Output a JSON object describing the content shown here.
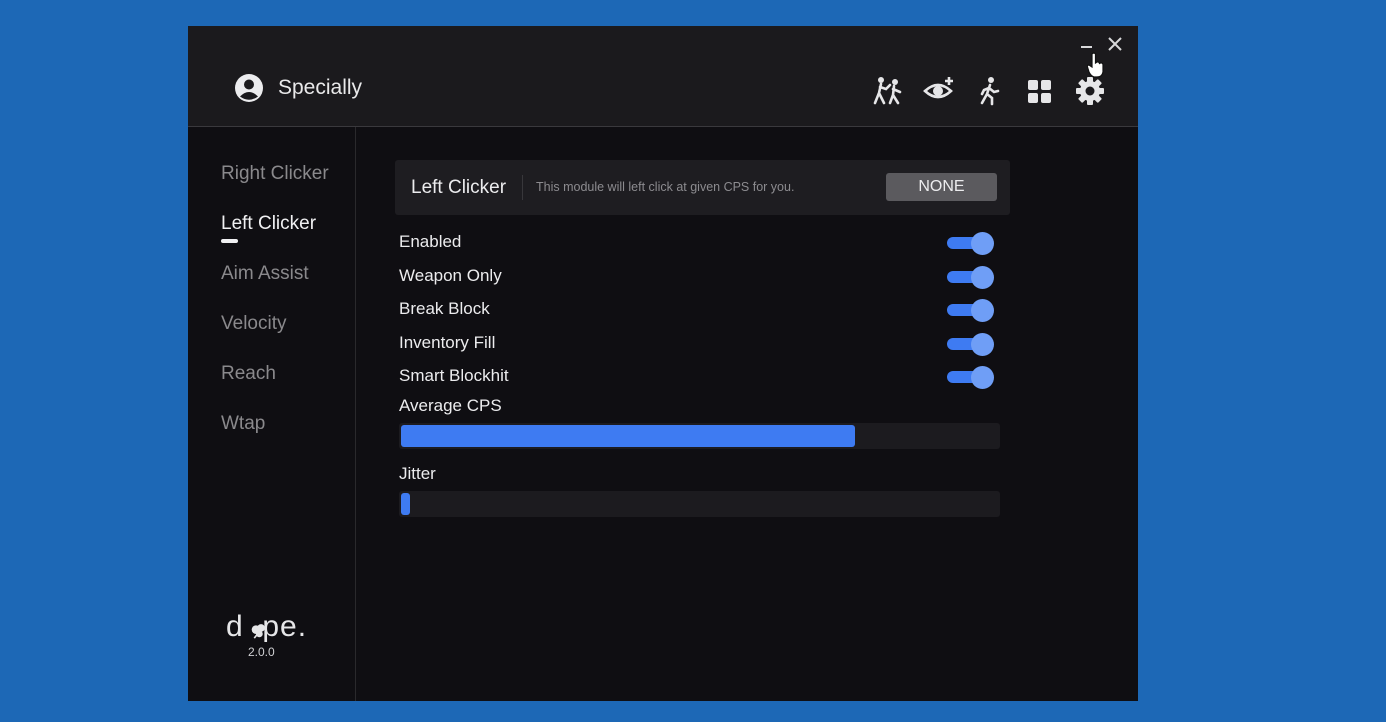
{
  "header": {
    "username": "Specially",
    "icons": [
      "user-icon",
      "combat-icon",
      "visuals-icon",
      "movement-icon",
      "grid-icon",
      "settings-icon"
    ]
  },
  "sidebar": {
    "items": [
      {
        "label": "Right Clicker",
        "active": false
      },
      {
        "label": "Left Clicker",
        "active": true
      },
      {
        "label": "Aim Assist",
        "active": false
      },
      {
        "label": "Velocity",
        "active": false
      },
      {
        "label": "Reach",
        "active": false
      },
      {
        "label": "Wtap",
        "active": false
      }
    ],
    "logo": "d  pe.",
    "version": "2.0.0"
  },
  "module": {
    "title": "Left Clicker",
    "description": "This module will left click at given CPS for you.",
    "bind_label": "NONE"
  },
  "options": [
    {
      "label": "Enabled",
      "on": true
    },
    {
      "label": "Weapon Only",
      "on": true
    },
    {
      "label": "Break Block",
      "on": true
    },
    {
      "label": "Inventory Fill",
      "on": true
    },
    {
      "label": "Smart Blockhit",
      "on": true
    }
  ],
  "sliders": [
    {
      "label": "Average CPS",
      "value_fraction": 0.76
    },
    {
      "label": "Jitter",
      "value_fraction": 0.015
    }
  ],
  "colors": {
    "accent": "#3e7bf2",
    "background": "#1d68b6",
    "window": "#0f0e12"
  }
}
